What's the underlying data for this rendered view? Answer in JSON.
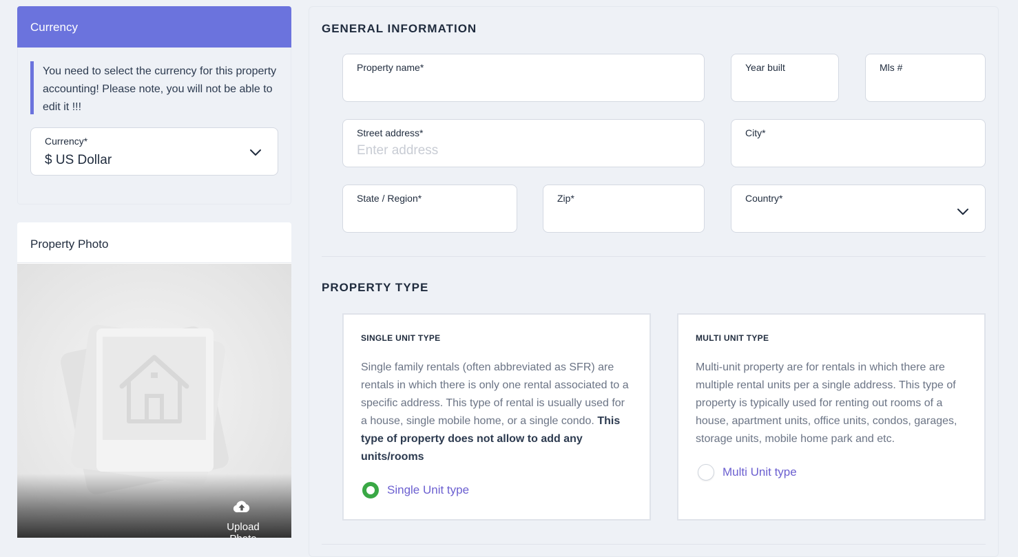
{
  "currency": {
    "title": "Currency",
    "note": "You need to select the currency for this property accounting! Please note, you will not be able to edit it !!!",
    "select_label": "Currency*",
    "select_value": "$ US Dollar"
  },
  "photo": {
    "title": "Property Photo",
    "upload_label": "Upload Photo"
  },
  "general": {
    "title": "GENERAL INFORMATION",
    "property_name_label": "Property name*",
    "year_built_label": "Year built",
    "mls_label": "Mls #",
    "street_label": "Street address*",
    "street_placeholder": "Enter address",
    "city_label": "City*",
    "state_label": "State / Region*",
    "zip_label": "Zip*",
    "country_label": "Country*"
  },
  "property_type": {
    "title": "PROPERTY TYPE",
    "single": {
      "title": "SINGLE UNIT TYPE",
      "desc_plain": "Single family rentals (often abbreviated as SFR) are rentals in which there is only one rental associated to a specific address. This type of rental is usually used for a house, single mobile home, or a single condo.",
      "desc_bold": "This type of property does not allow to add any units/rooms",
      "radio_label": "Single Unit type",
      "selected": true
    },
    "multi": {
      "title": "MULTI UNIT TYPE",
      "desc_plain": "Multi-unit property are for rentals in which there are multiple rental units per a single address. This type of property is typically used for renting out rooms of a house, apartment units, office units, condos, garages, storage units, mobile home park and etc.",
      "radio_label": "Multi Unit type",
      "selected": false
    }
  },
  "colors": {
    "accent": "#6b73dd",
    "radio_selected": "#39a845",
    "radio_label": "#6b5fd0"
  }
}
